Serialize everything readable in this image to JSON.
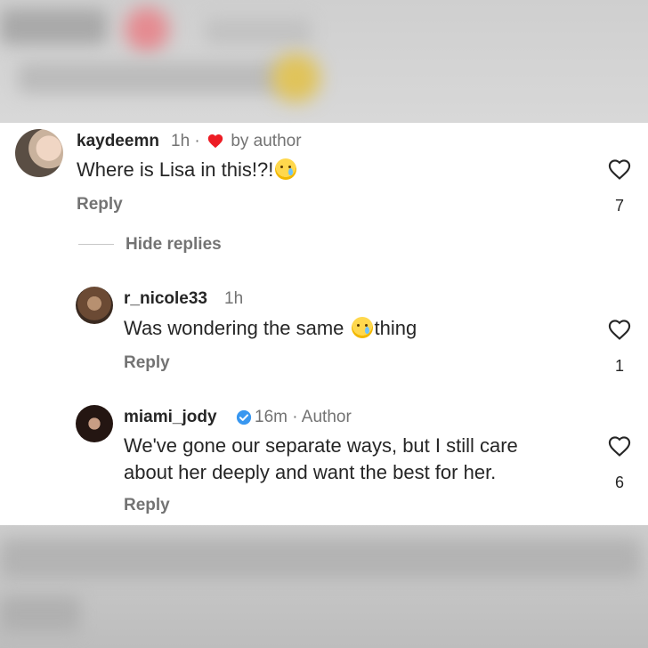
{
  "comments": [
    {
      "username": "kaydeemn",
      "time": "1h ·",
      "liked_by": "by author",
      "text": "Where is Lisa in this!?!",
      "reply_label": "Reply",
      "likes": "7"
    }
  ],
  "thread": {
    "hide_replies_label": "Hide replies",
    "replies": [
      {
        "username": "r_nicole33",
        "time": "1h",
        "text_before": "Was wondering the same",
        "text_after": "thing",
        "reply_label": "Reply",
        "likes": "1"
      },
      {
        "username": "miami_jody",
        "time": "16m · Author",
        "text_line1": "We've gone our separate ways, but I still care",
        "text_line2": "about her deeply and want the best for her.",
        "reply_label": "Reply",
        "likes": "6"
      }
    ]
  },
  "colors": {
    "text_primary": "#262626",
    "text_secondary": "#737373",
    "heart_red": "#ed1c24",
    "verified_blue": "#3897f0"
  },
  "icons": [
    "heart-outline-icon",
    "red-heart-icon",
    "verified-badge-icon",
    "crying-face-emoji"
  ]
}
